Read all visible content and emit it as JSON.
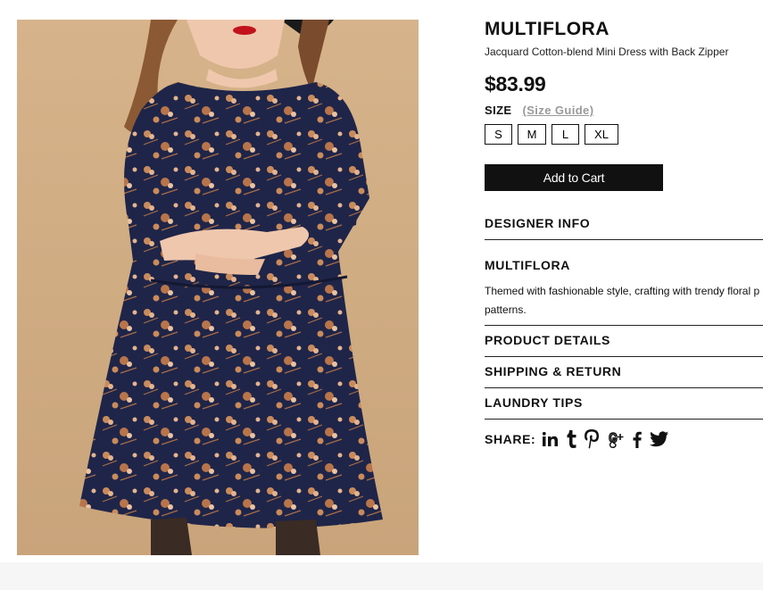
{
  "product": {
    "brand": "MULTIFLORA",
    "name": "Jacquard Cotton-blend Mini Dress with Back Zipper",
    "price": "$83.99",
    "size_label": "SIZE",
    "size_guide": "(Size Guide)",
    "sizes": [
      "S",
      "M",
      "L",
      "XL"
    ],
    "add_to_cart": "Add to Cart"
  },
  "sections": {
    "designer_info": "DESIGNER INFO",
    "designer_name": "MULTIFLORA",
    "designer_desc_line1": "Themed with fashionable style, crafting with trendy floral p",
    "designer_desc_line2": "patterns.",
    "product_details": "PRODUCT DETAILS",
    "shipping_return": "SHIPPING & RETURN",
    "laundry_tips": "LAUNDRY TIPS"
  },
  "share": {
    "label": "SHARE:",
    "icons": [
      "linkedin-icon",
      "tumblr-icon",
      "pinterest-icon",
      "google-plus-icon",
      "facebook-icon",
      "twitter-icon"
    ]
  },
  "colors": {
    "photo_background": "#d2ae85",
    "dress_navy": "#1f2548",
    "floral_copper": "#c98a5c",
    "button_black": "#111111",
    "size_guide_gray": "#9a9a9a"
  }
}
